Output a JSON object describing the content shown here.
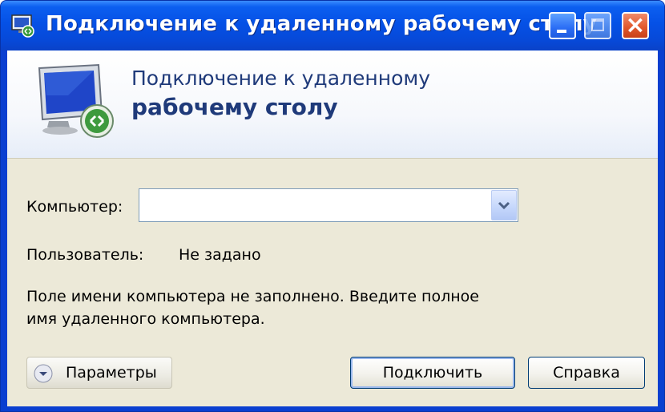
{
  "window": {
    "title": "Подключение к удаленному рабочему столу"
  },
  "banner": {
    "line1": "Подключение к удаленному",
    "line2": "рабочему столу"
  },
  "form": {
    "computer_label": "Компьютер:",
    "computer_value": "",
    "user_label": "Пользователь:",
    "user_value": "Не задано",
    "message_line1": "Поле имени компьютера не заполнено. Введите полное",
    "message_line2": "имя удаленного компьютера."
  },
  "buttons": {
    "params": "Параметры",
    "connect": "Подключить",
    "help": "Справка"
  },
  "icons": {
    "app": "remote-desktop-icon",
    "banner": "remote-desktop-monitor-icon",
    "params": "chevron-down-circle-icon",
    "dropdown": "chevron-down-icon"
  },
  "colors": {
    "titlebar": "#0551e6",
    "banner_text": "#1f3a7a",
    "dialog_bg": "#ece9d8"
  }
}
